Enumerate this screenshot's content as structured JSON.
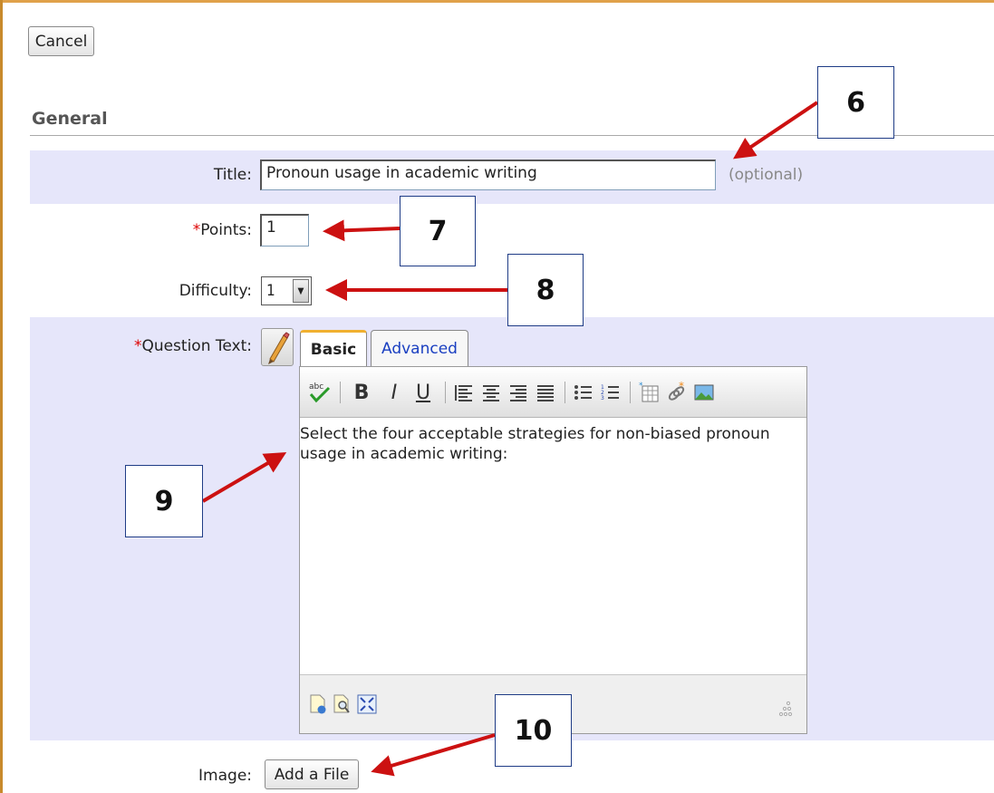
{
  "actions": {
    "cancel_label": "Cancel",
    "add_file_label": "Add a File"
  },
  "section": {
    "title": "General"
  },
  "form": {
    "title_label": "Title:",
    "title_value": "Pronoun usage in academic writing",
    "title_hint": "(optional)",
    "required_marker": "*",
    "points_label": "Points:",
    "points_value": "1",
    "difficulty_label": "Difficulty:",
    "difficulty_value": "1",
    "question_label": "Question Text:",
    "image_label": "Image:"
  },
  "editor": {
    "tabs": [
      {
        "label": "Basic",
        "active": true
      },
      {
        "label": "Advanced",
        "active": false
      }
    ],
    "toolbar_icons": [
      "spellcheck-icon",
      "bold-icon",
      "italic-icon",
      "underline-icon",
      "align-left-icon",
      "align-center-icon",
      "align-right-icon",
      "align-justify-icon",
      "bullet-list-icon",
      "numbered-list-icon",
      "insert-table-icon",
      "insert-link-icon",
      "insert-image-icon"
    ],
    "toolbar_glyphs": {
      "bold": "B",
      "italic": "I",
      "underline": "U"
    },
    "content_line1": "Select the four acceptable strategies for non-biased pronoun",
    "content_line2": "usage in academic writing:",
    "status_icons": [
      "insert-file-icon",
      "preview-icon",
      "fullscreen-icon",
      "resize-grip-icon"
    ]
  },
  "annotations": {
    "six": "6",
    "seven": "7",
    "eight": "8",
    "nine": "9",
    "ten": "10"
  },
  "colors": {
    "band": "#e6e6fa",
    "required": "#dd0000",
    "arrow": "#cc1111",
    "link": "#1a3fc1",
    "frame": "#e0a14a"
  }
}
